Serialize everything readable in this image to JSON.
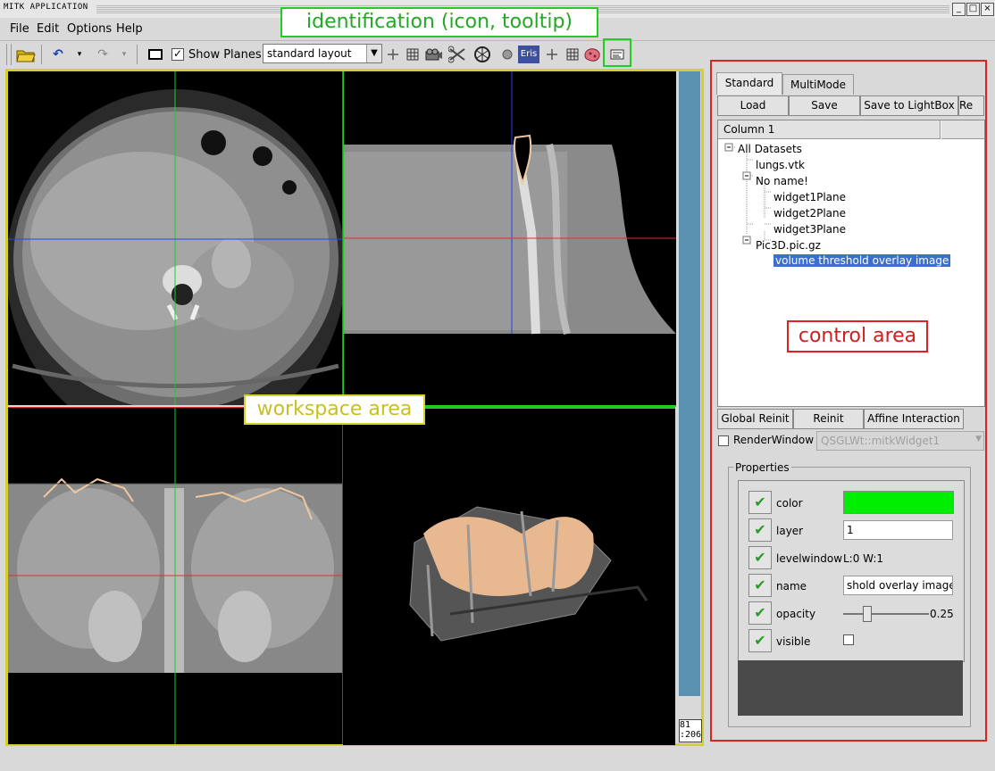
{
  "window": {
    "title": "MITK APPLICATION",
    "min_btn": "_",
    "max_btn": "□",
    "close_btn": "×"
  },
  "menubar": {
    "file": "File",
    "edit": "Edit",
    "options": "Options",
    "help": "Help"
  },
  "toolbar": {
    "show_planes_label": "Show Planes",
    "show_planes_checked": true,
    "layout_combo_value": "standard layout",
    "eris_label": "Eris"
  },
  "annotations": {
    "identification": "identification (icon, tooltip)",
    "workspace": "workspace area",
    "control": "control area"
  },
  "workspace": {
    "coord_x": "81",
    "coord_y": ":206"
  },
  "control": {
    "tabs": [
      "Standard",
      "MultiMode"
    ],
    "buttons": [
      "Load",
      "Save",
      "Save to LightBox",
      "Re"
    ],
    "column_header": "Column 1",
    "tree": {
      "root": "All Datasets",
      "items": [
        "lungs.vtk",
        "No name!",
        "widget1Plane",
        "widget2Plane",
        "widget3Plane",
        "Pic3D.pic.gz",
        "volume threshold overlay image"
      ]
    },
    "action_buttons": [
      "Global Reinit",
      "Reinit",
      "Affine Interaction"
    ],
    "render_window_label": "RenderWindow",
    "render_window_combo": "QSGLWt::mitkWidget1",
    "properties_title": "Properties",
    "properties": {
      "color_label": "color",
      "color_value": "#00ee00",
      "layer_label": "layer",
      "layer_value": "1",
      "levelwindow_label": "levelwindow",
      "levelwindow_value": "L:0 W:1",
      "name_label": "name",
      "name_value": "shold overlay image",
      "opacity_label": "opacity",
      "opacity_value": "0.25",
      "visible_label": "visible"
    }
  }
}
